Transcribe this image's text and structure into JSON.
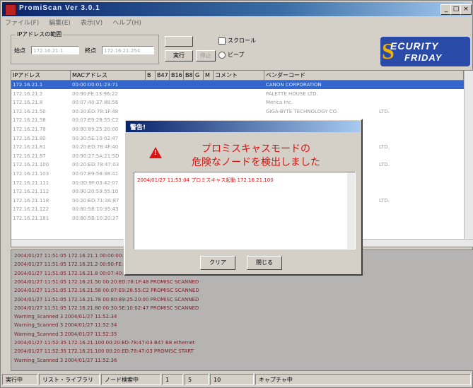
{
  "window": {
    "title": "PromiScan Ver 3.0.1"
  },
  "menu": [
    "ファイル(F)",
    "編集(E)",
    "表示(V)",
    "ヘルプ(H)"
  ],
  "ip_group": {
    "legend": "IPアドレスの範囲",
    "start_label": "始点",
    "start_value": "172.16.21.1",
    "end_label": "終点",
    "end_value": "172.16.21.254"
  },
  "controls": {
    "run_label": "実行",
    "stop_label": "停止",
    "clear_label": "クリア",
    "check_label": "スクロール",
    "radio_label": "ビープ"
  },
  "logo": {
    "line1": "ECURITY",
    "line2": "FRIDAY",
    "initial": "S"
  },
  "table": {
    "columns": [
      "IPアドレス",
      "MACアドレス",
      "B",
      "B47",
      "B16",
      "B8",
      "G",
      "M",
      "コメント",
      "ベンダーコード"
    ],
    "rows": [
      {
        "ip": "172.16.21.1",
        "mac": "00:00:00:01:23:71",
        "vendor": "CANON CORPORATION",
        "extra": ""
      },
      {
        "ip": "172.16.21.2",
        "mac": "00:90:FE:13:96:22",
        "vendor": "PALETTE HOUSE LTD.",
        "extra": ""
      },
      {
        "ip": "172.16.21.8",
        "mac": "00:07:40:37:88:56",
        "vendor": "Merica Inc.",
        "extra": ""
      },
      {
        "ip": "172.16.21.50",
        "mac": "00:20:ED:78:1F:48",
        "vendor": "GIGA-BYTE TECHNOLOGY CO.",
        "extra": "LTD."
      },
      {
        "ip": "172.16.21.58",
        "mac": "00:07:E9:28:55:C2",
        "vendor": "",
        "extra": ""
      },
      {
        "ip": "172.16.21.78",
        "mac": "00:80:89:25:20:00",
        "vendor": "",
        "extra": ""
      },
      {
        "ip": "172.16.21.80",
        "mac": "00:30:5E:10:02:47",
        "vendor": "",
        "extra": ""
      },
      {
        "ip": "172.16.21.81",
        "mac": "00:20:ED:78:4F:40",
        "vendor": "",
        "extra": "LTD."
      },
      {
        "ip": "172.16.21.87",
        "mac": "00:90:27:5A:21:5D",
        "vendor": "",
        "extra": ""
      },
      {
        "ip": "172.16.21.100",
        "mac": "00:20:ED:78:47:03",
        "vendor": "",
        "extra": "LTD."
      },
      {
        "ip": "172.16.21.103",
        "mac": "00:07:E9:58:38:41",
        "vendor": "",
        "extra": ""
      },
      {
        "ip": "172.16.21.111",
        "mac": "00:0D:9F:03:42:07",
        "vendor": "",
        "extra": ""
      },
      {
        "ip": "172.16.21.112",
        "mac": "00:90:20:59:55:10",
        "vendor": "",
        "extra": ""
      },
      {
        "ip": "172.16.21.118",
        "mac": "00:20:ED:71:3A:87",
        "vendor": "",
        "extra": "LTD."
      },
      {
        "ip": "172.16.21.122",
        "mac": "00:80:5B:10:95:43",
        "vendor": "",
        "extra": ""
      },
      {
        "ip": "172.16.21.181",
        "mac": "00:80:5B:10:20:37",
        "vendor": "",
        "extra": ""
      }
    ]
  },
  "log_lines": [
    "2004/01/27 11:51:05   172.16.21.1   00:00:00:01:23:71   PROMISC  SCANNED",
    "2004/01/27 11:51:05   172.16.21.2   00:90:FE:13:96:22   PROMISC  SCANNED",
    "2004/01/27 11:51:05   172.16.21.8   00:07:40:37:88:56   PROMISC  SCANNED",
    "2004/01/27 11:51:05   172.16.21.50   00:20:ED:78:1F:48   PROMISC  SCANNED",
    "2004/01/27 11:51:05   172.16.21.58   00:07:E9:28:55:C2   PROMISC  SCANNED",
    "2004/01/27 11:51:05   172.16.21.78   00:80:89:25:20:00   PROMISC  SCANNED",
    "2004/01/27 11:51:05   172.16.21.80   00:30:5E:10:02:47   PROMISC  SCANNED",
    "Warning_Scanned   3      2004/01/27 11:52:34",
    "Warning_Scanned   3      2004/01/27 11:52:34",
    "Warning_Scanned   3      2004/01/27 11:52:35",
    "2004/01/27 11:52:35   172.16.21.100   00:20:ED:78:47:03   B47  B8   ethernet",
    "2004/01/27 11:52:35   172.16.21.100   00:20:ED:78:47:03   PROMISC  START",
    "Warning_Scanned   3      2004/01/27 11:52:36"
  ],
  "status": [
    "実行中",
    "リスト・ライブラリ",
    "ノード検索中",
    "1",
    "5",
    "10",
    "キャプチャ中"
  ],
  "dialog": {
    "title": "警告!",
    "message_line1": "プロミスキャスモードの",
    "message_line2": "危険なノードを検出しました",
    "log_entry": "2004/01/27 11:53:04  プロミスキャス起動 172.16.21.100",
    "clear_label": "クリア",
    "close_label": "閉じる"
  },
  "colors": {
    "selection": "#3366cc",
    "alert": "#dd1111",
    "log_text": "#7a1f2a",
    "title_bar": "#0a246a"
  }
}
